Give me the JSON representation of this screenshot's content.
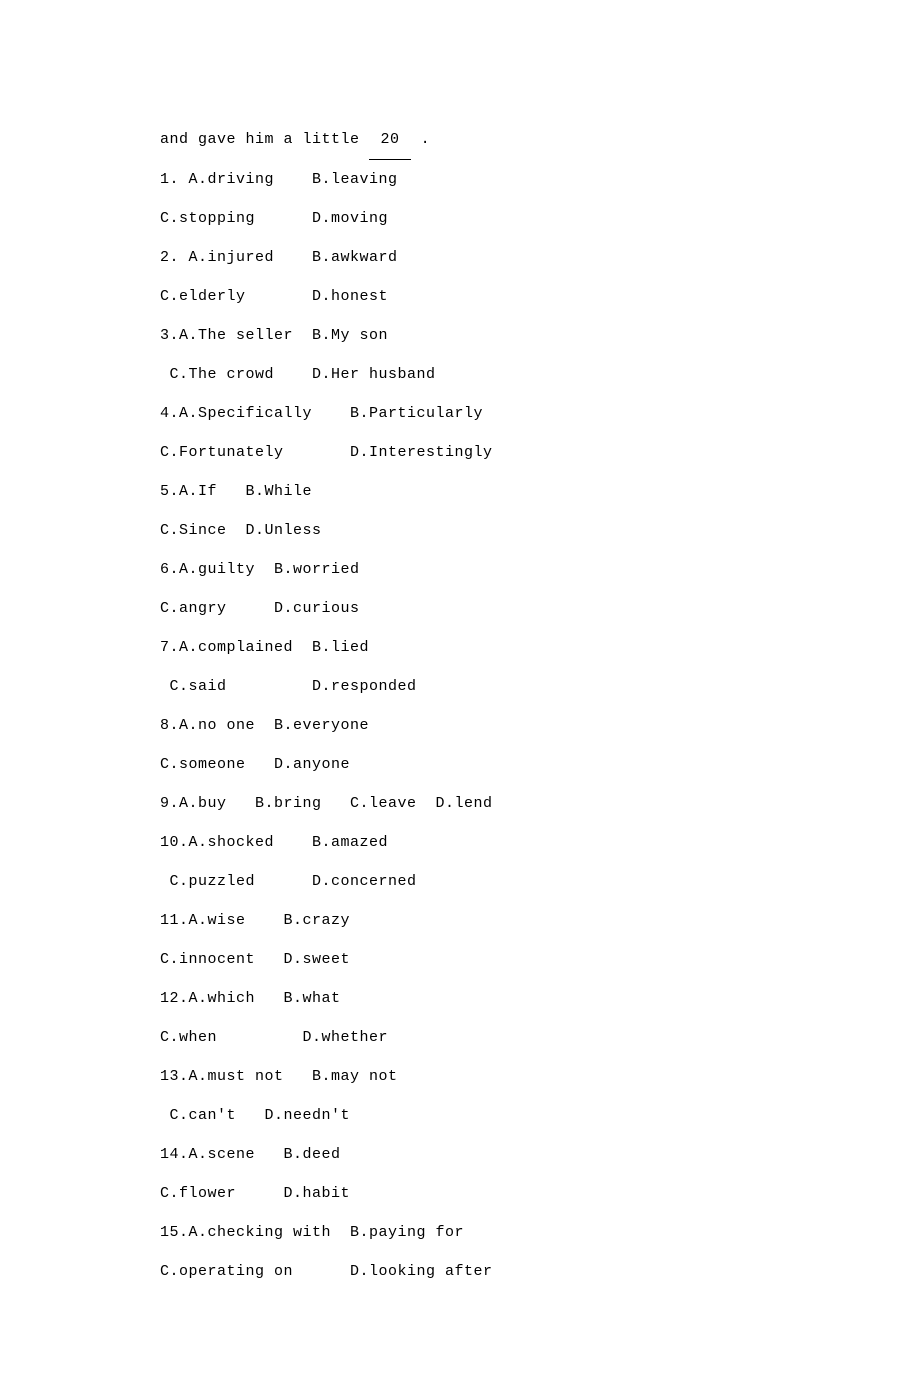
{
  "intro": {
    "prefix": "and gave him a little ",
    "blank": " 20 ",
    "suffix": " ."
  },
  "lines": [
    "1. A.driving    B.leaving",
    "C.stopping      D.moving",
    "2. A.injured    B.awkward",
    "C.elderly       D.honest",
    "3.A.The seller  B.My son",
    " C.The crowd    D.Her husband",
    "4.A.Specifically    B.Particularly",
    "C.Fortunately       D.Interestingly",
    "5.A.If   B.While",
    "C.Since  D.Unless",
    "6.A.guilty  B.worried",
    "C.angry     D.curious",
    "7.A.complained  B.lied",
    " C.said         D.responded",
    "8.A.no one  B.everyone",
    "C.someone   D.anyone",
    "9.A.buy   B.bring   C.leave  D.lend",
    "10.A.shocked    B.amazed",
    " C.puzzled      D.concerned",
    "11.A.wise    B.crazy",
    "C.innocent   D.sweet",
    "12.A.which   B.what",
    "C.when         D.whether",
    "13.A.must not   B.may not",
    " C.can't   D.needn't",
    "14.A.scene   B.deed",
    "C.flower     D.habit",
    "15.A.checking with  B.paying for",
    "C.operating on      D.looking after"
  ]
}
